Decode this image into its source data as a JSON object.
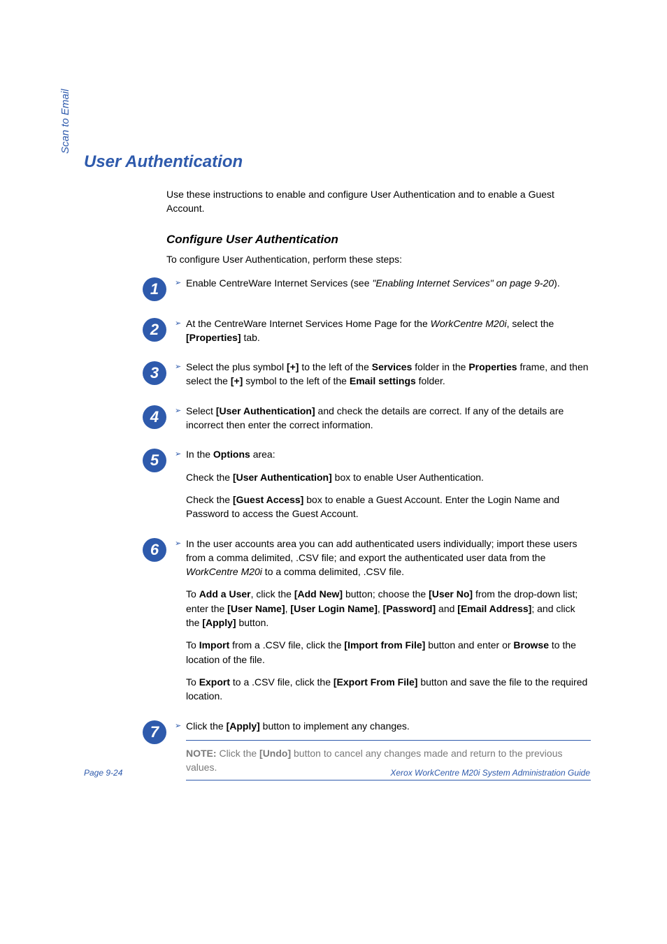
{
  "sidebar": {
    "label": "Scan to Email"
  },
  "title": "User Authentication",
  "intro": "Use these instructions to enable and configure User Authentication and to enable a Guest Account.",
  "subhead": "Configure User Authentication",
  "lead": "To configure User Authentication, perform these steps:",
  "steps": {
    "s1": {
      "num": "1",
      "line1_pre": "Enable CentreWare Internet Services (see ",
      "line1_ref": "\"Enabling Internet Services\" on page 9-20",
      "line1_post": ")."
    },
    "s2": {
      "num": "2",
      "line1_a": "At the CentreWare Internet Services Home Page for the ",
      "line1_b": "WorkCentre M20i",
      "line1_c": ", select the ",
      "line1_d": "[Properties]",
      "line1_e": " tab."
    },
    "s3": {
      "num": "3",
      "a": "Select the plus symbol ",
      "b": "[+]",
      "c": " to the left of the ",
      "d": "Services",
      "e": " folder in the ",
      "f": "Properties",
      "g": " frame, and then select the ",
      "h": "[+]",
      "i": " symbol to the left of the ",
      "j": "Email settings",
      "k": " folder."
    },
    "s4": {
      "num": "4",
      "a": "Select ",
      "b": "[User Authentication]",
      "c": " and check the details are correct. If any of the details are incorrect then enter the correct information."
    },
    "s5": {
      "num": "5",
      "head_a": "In the ",
      "head_b": "Options",
      "head_c": " area:",
      "p1_a": "Check the ",
      "p1_b": "[User Authentication]",
      "p1_c": " box to enable User Authentication.",
      "p2_a": "Check the ",
      "p2_b": "[Guest Access]",
      "p2_c": " box to enable a Guest Account. Enter the Login Name and Password to access the Guest Account."
    },
    "s6": {
      "num": "6",
      "head_a": "In the user accounts area you can add authenticated users individually; import these users from a comma delimited, .CSV file; and export the authenticated user data from the ",
      "head_b": "WorkCentre M20i",
      "head_c": " to a comma delimited, .CSV file.",
      "p1_a": "To ",
      "p1_b": "Add a User",
      "p1_c": ", click the ",
      "p1_d": "[Add New]",
      "p1_e": " button; choose the ",
      "p1_f": "[User No]",
      "p1_g": " from the drop-down list; enter the ",
      "p1_h": "[User Name]",
      "p1_i": ", ",
      "p1_j": "[User Login Name]",
      "p1_k": ", ",
      "p1_l": "[Password]",
      "p1_m": " and ",
      "p1_n": "[Email Address]",
      "p1_o": "; and click the ",
      "p1_p": "[Apply]",
      "p1_q": " button.",
      "p2_a": "To ",
      "p2_b": "Import",
      "p2_c": " from a .CSV file, click the ",
      "p2_d": "[Import from File]",
      "p2_e": " button and enter or ",
      "p2_f": "Browse",
      "p2_g": " to the location of the file.",
      "p3_a": "To ",
      "p3_b": "Export",
      "p3_c": " to a .CSV file, click the ",
      "p3_d": "[Export From File]",
      "p3_e": " button and save the file to the required location."
    },
    "s7": {
      "num": "7",
      "a": "Click the ",
      "b": "[Apply]",
      "c": " button to implement any changes.",
      "note_a": "NOTE:",
      "note_b": " Click the ",
      "note_c": "[Undo]",
      "note_d": " button to cancel any changes made and return to the previous values."
    }
  },
  "footer": {
    "left": "Page 9-24",
    "right": "Xerox WorkCentre M20i System Administration Guide"
  }
}
